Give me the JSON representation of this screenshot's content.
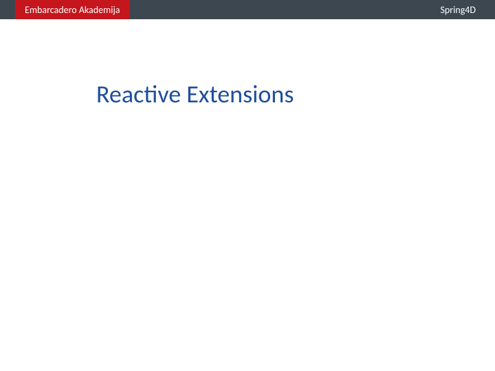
{
  "header": {
    "badge_text": "Embarcadero Akademija",
    "right_text": "Spring4D"
  },
  "slide": {
    "title": "Reactive Extensions"
  },
  "colors": {
    "header_bg": "#3d4750",
    "badge_bg": "#c4161c",
    "title_color": "#1f4e9b"
  }
}
